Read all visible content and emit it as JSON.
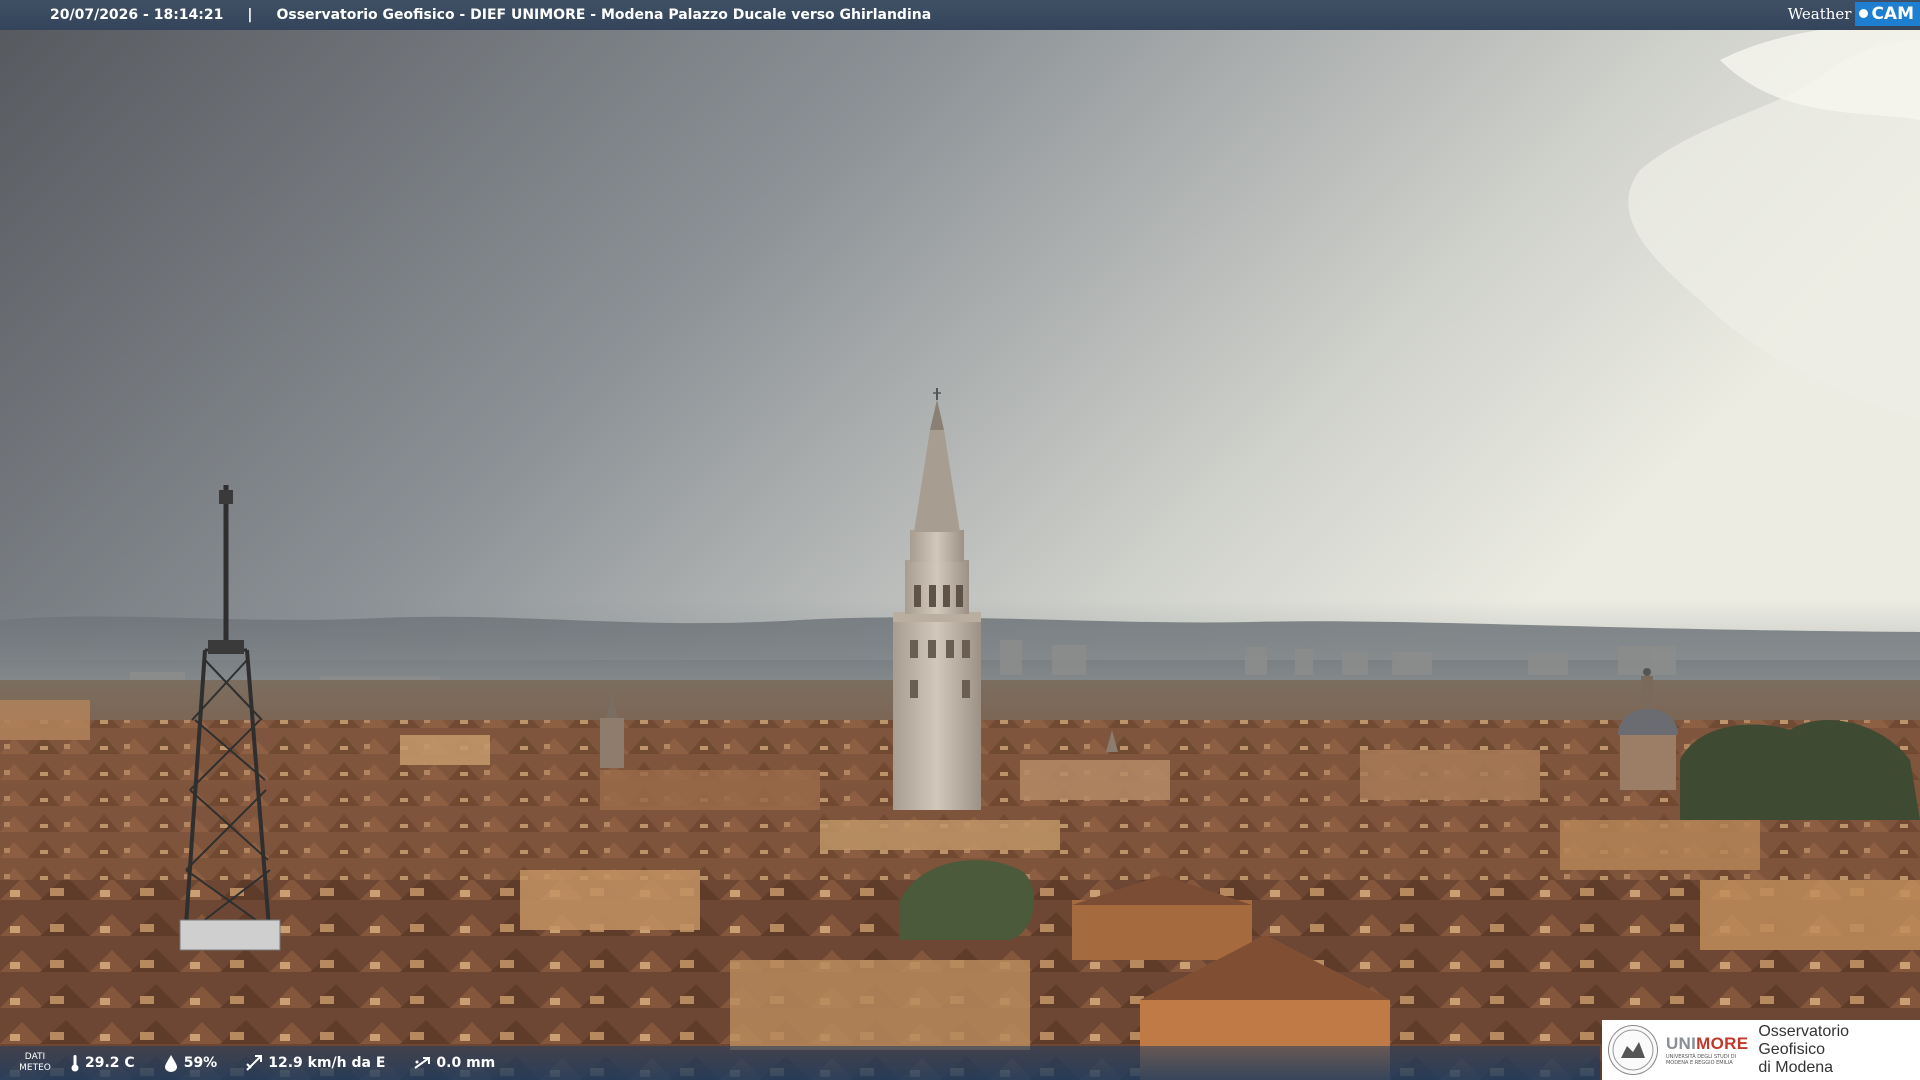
{
  "header": {
    "timestamp": "20/07/2026 - 18:14:21",
    "separator": "|",
    "caption": "Osservatorio Geofisico - DIEF UNIMORE - Modena Palazzo Ducale verso Ghirlandina",
    "brand_weather": "Weather",
    "brand_cam": "CAM"
  },
  "weather": {
    "label_line1": "DATI",
    "label_line2": "METEO",
    "temperature": "29.2 C",
    "humidity": "59%",
    "wind": "12.9 km/h da E",
    "rain": "0.0 mm",
    "icons": [
      "thermometer-icon",
      "humidity-drop-icon",
      "wind-vane-icon",
      "rain-gauge-icon"
    ]
  },
  "logo": {
    "uni_prefix": "UNI",
    "uni_suffix": "MORE",
    "uni_subtitle": "UNIVERSITÀ DEGLI STUDI DI MODENA E REGGIO EMILIA",
    "observatory_line1": "Osservatorio Geofisico",
    "observatory_line2": "di Modena"
  },
  "colors": {
    "sky_top": "#55585d",
    "sky_right": "#e9eadf",
    "roof": "#8a5a3e",
    "tower": "#c9bfb2",
    "accent_blue": "#1e7fd0",
    "unimore_red": "#c0392b"
  }
}
